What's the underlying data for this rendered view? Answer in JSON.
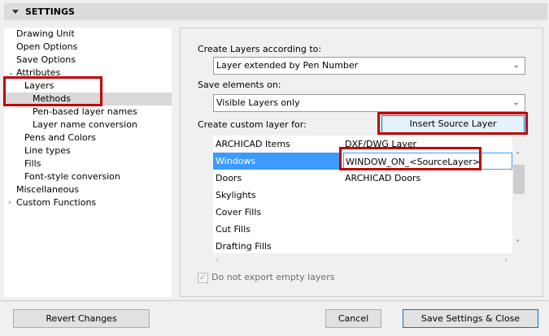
{
  "header": {
    "title": "SETTINGS"
  },
  "tree": [
    {
      "label": "Drawing Unit",
      "level": 0,
      "expander": ""
    },
    {
      "label": "Open Options",
      "level": 0,
      "expander": ""
    },
    {
      "label": "Save Options",
      "level": 0,
      "expander": ""
    },
    {
      "label": "Attributes",
      "level": 0,
      "expander": "⌄"
    },
    {
      "label": "Layers",
      "level": 1,
      "expander": "⌄"
    },
    {
      "label": "Methods",
      "level": 2,
      "expander": "",
      "selected": true
    },
    {
      "label": "Pen-based layer names",
      "level": 2,
      "expander": ""
    },
    {
      "label": "Layer name conversion",
      "level": 2,
      "expander": ""
    },
    {
      "label": "Pens and Colors",
      "level": 1,
      "expander": "›"
    },
    {
      "label": "Line types",
      "level": 1,
      "expander": "›"
    },
    {
      "label": "Fills",
      "level": 1,
      "expander": "›"
    },
    {
      "label": "Font-style conversion",
      "level": 1,
      "expander": ""
    },
    {
      "label": "Miscellaneous",
      "level": 0,
      "expander": ""
    },
    {
      "label": "Custom Functions",
      "level": 0,
      "expander": "›"
    }
  ],
  "main": {
    "create_layers_label": "Create Layers according to:",
    "create_layers_value": "Layer extended by Pen Number",
    "save_elements_label": "Save elements on:",
    "save_elements_value": "Visible Layers only",
    "custom_layer_label": "Create custom layer for:",
    "insert_button": "Insert Source Layer",
    "table": {
      "headers": [
        "ARCHICAD Items",
        "DXF/DWG Layer"
      ],
      "rows": [
        {
          "item": "Windows",
          "layer": "WINDOW_ON_<SourceLayer>",
          "selected": true
        },
        {
          "item": "Doors",
          "layer": "ARCHICAD Doors"
        },
        {
          "item": "Skylights",
          "layer": ""
        },
        {
          "item": "Cover Fills",
          "layer": ""
        },
        {
          "item": "Cut Fills",
          "layer": ""
        },
        {
          "item": "Drafting Fills",
          "layer": ""
        }
      ]
    },
    "checkbox_label": "Do not export empty layers",
    "checkbox_checked": true
  },
  "footer": {
    "revert": "Revert Changes",
    "cancel": "Cancel",
    "save": "Save Settings & Close"
  }
}
